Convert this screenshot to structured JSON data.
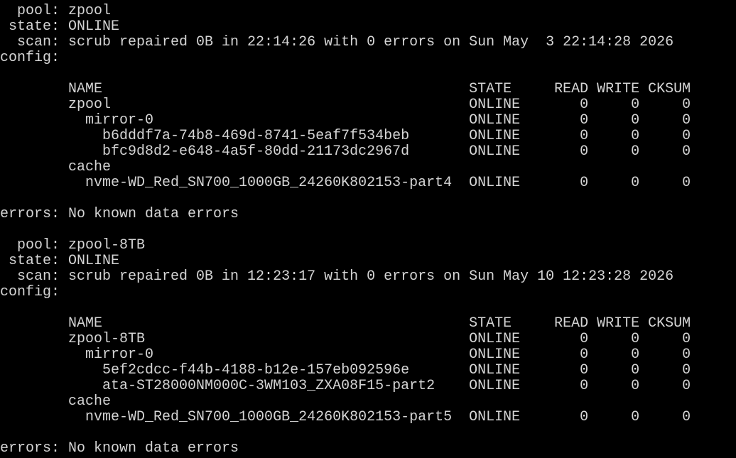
{
  "terminal": {
    "cursor_color": "#22c55e",
    "lines": [
      "  pool: zpool",
      " state: ONLINE",
      "  scan: scrub repaired 0B in 22:14:26 with 0 errors on Sun May  3 22:14:28 2026",
      "config:",
      "",
      "        NAME                                           STATE     READ WRITE CKSUM",
      "        zpool                                          ONLINE       0     0     0",
      "          mirror-0                                     ONLINE       0     0     0",
      "            b6dddf7a-74b8-469d-8741-5eaf7f534beb       ONLINE       0     0     0",
      "            bfc9d8d2-e648-4a5f-80dd-21173dc2967d       ONLINE       0     0     0",
      "        cache",
      "          nvme-WD_Red_SN700_1000GB_24260K802153-part4  ONLINE       0     0     0",
      "",
      "errors: No known data errors",
      "",
      "  pool: zpool-8TB",
      " state: ONLINE",
      "  scan: scrub repaired 0B in 12:23:17 with 0 errors on Sun May 10 12:23:28 2026",
      "config:",
      "",
      "        NAME                                           STATE     READ WRITE CKSUM",
      "        zpool-8TB                                      ONLINE       0     0     0",
      "          mirror-0                                     ONLINE       0     0     0",
      "            5ef2cdcc-f44b-4188-b12e-157eb092596e       ONLINE       0     0     0",
      "            ata-ST28000NM000C-3WM103_ZXA08F15-part2    ONLINE       0     0     0",
      "        cache",
      "          nvme-WD_Red_SN700_1000GB_24260K802153-part5  ONLINE       0     0     0",
      "",
      "errors: No known data errors",
      ""
    ]
  }
}
